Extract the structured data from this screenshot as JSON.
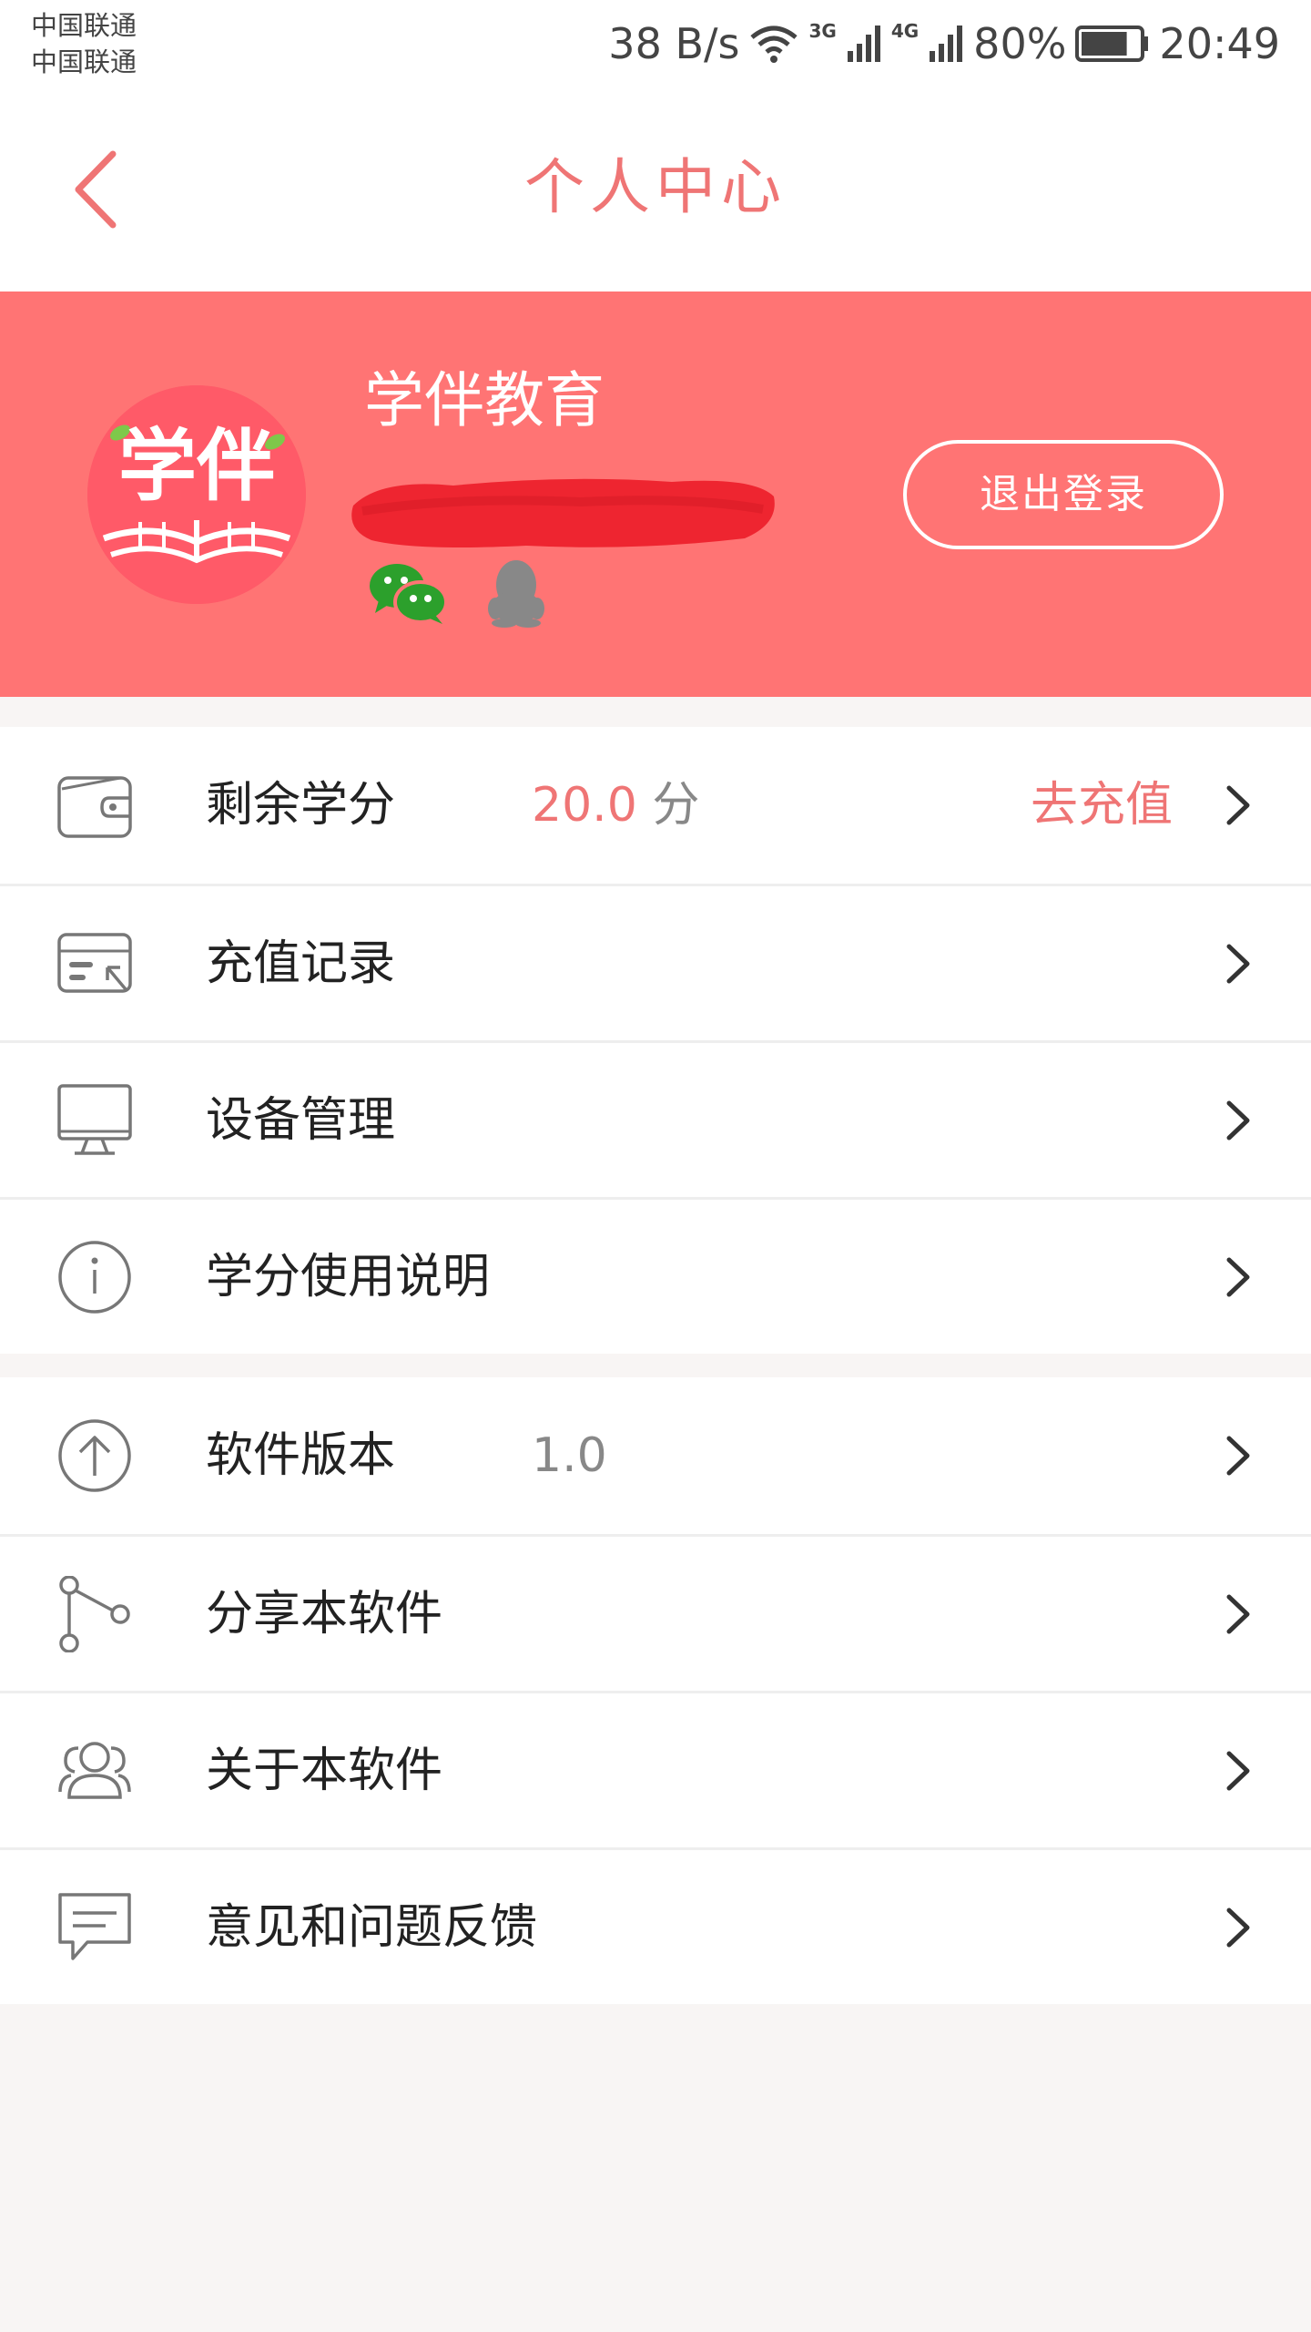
{
  "status_bar": {
    "carrier_1": "中国联通",
    "carrier_2": "中国联通",
    "net_speed": "38 B/s",
    "badge_3g": "3G",
    "badge_4g": "4G",
    "battery": "80%",
    "battery_level": 0.8,
    "time": "20:49"
  },
  "header": {
    "title": "个人中心",
    "back_icon": "chevron-left-icon"
  },
  "profile": {
    "name": "学伴教育",
    "avatar_text": "学伴",
    "logout_label": "退出登录",
    "social_icons": [
      "wechat-icon",
      "qq-icon"
    ]
  },
  "menu_group_1": {
    "items": [
      {
        "icon": "wallet-icon",
        "label": "剩余学分",
        "value": "20.0",
        "unit": "分",
        "action": "去充值"
      },
      {
        "icon": "record-icon",
        "label": "充值记录"
      },
      {
        "icon": "monitor-icon",
        "label": "设备管理"
      },
      {
        "icon": "info-icon",
        "label": "学分使用说明"
      }
    ]
  },
  "menu_group_2": {
    "items": [
      {
        "icon": "upload-icon",
        "label": "软件版本",
        "value": "1.0"
      },
      {
        "icon": "share-icon",
        "label": "分享本软件"
      },
      {
        "icon": "people-icon",
        "label": "关于本软件"
      },
      {
        "icon": "feedback-icon",
        "label": "意见和问题反馈"
      }
    ]
  },
  "colors": {
    "accent": "#ef7575",
    "banner": "#ff7474",
    "avatar_bg": "#ff5a68",
    "background": "#f8f5f4"
  }
}
